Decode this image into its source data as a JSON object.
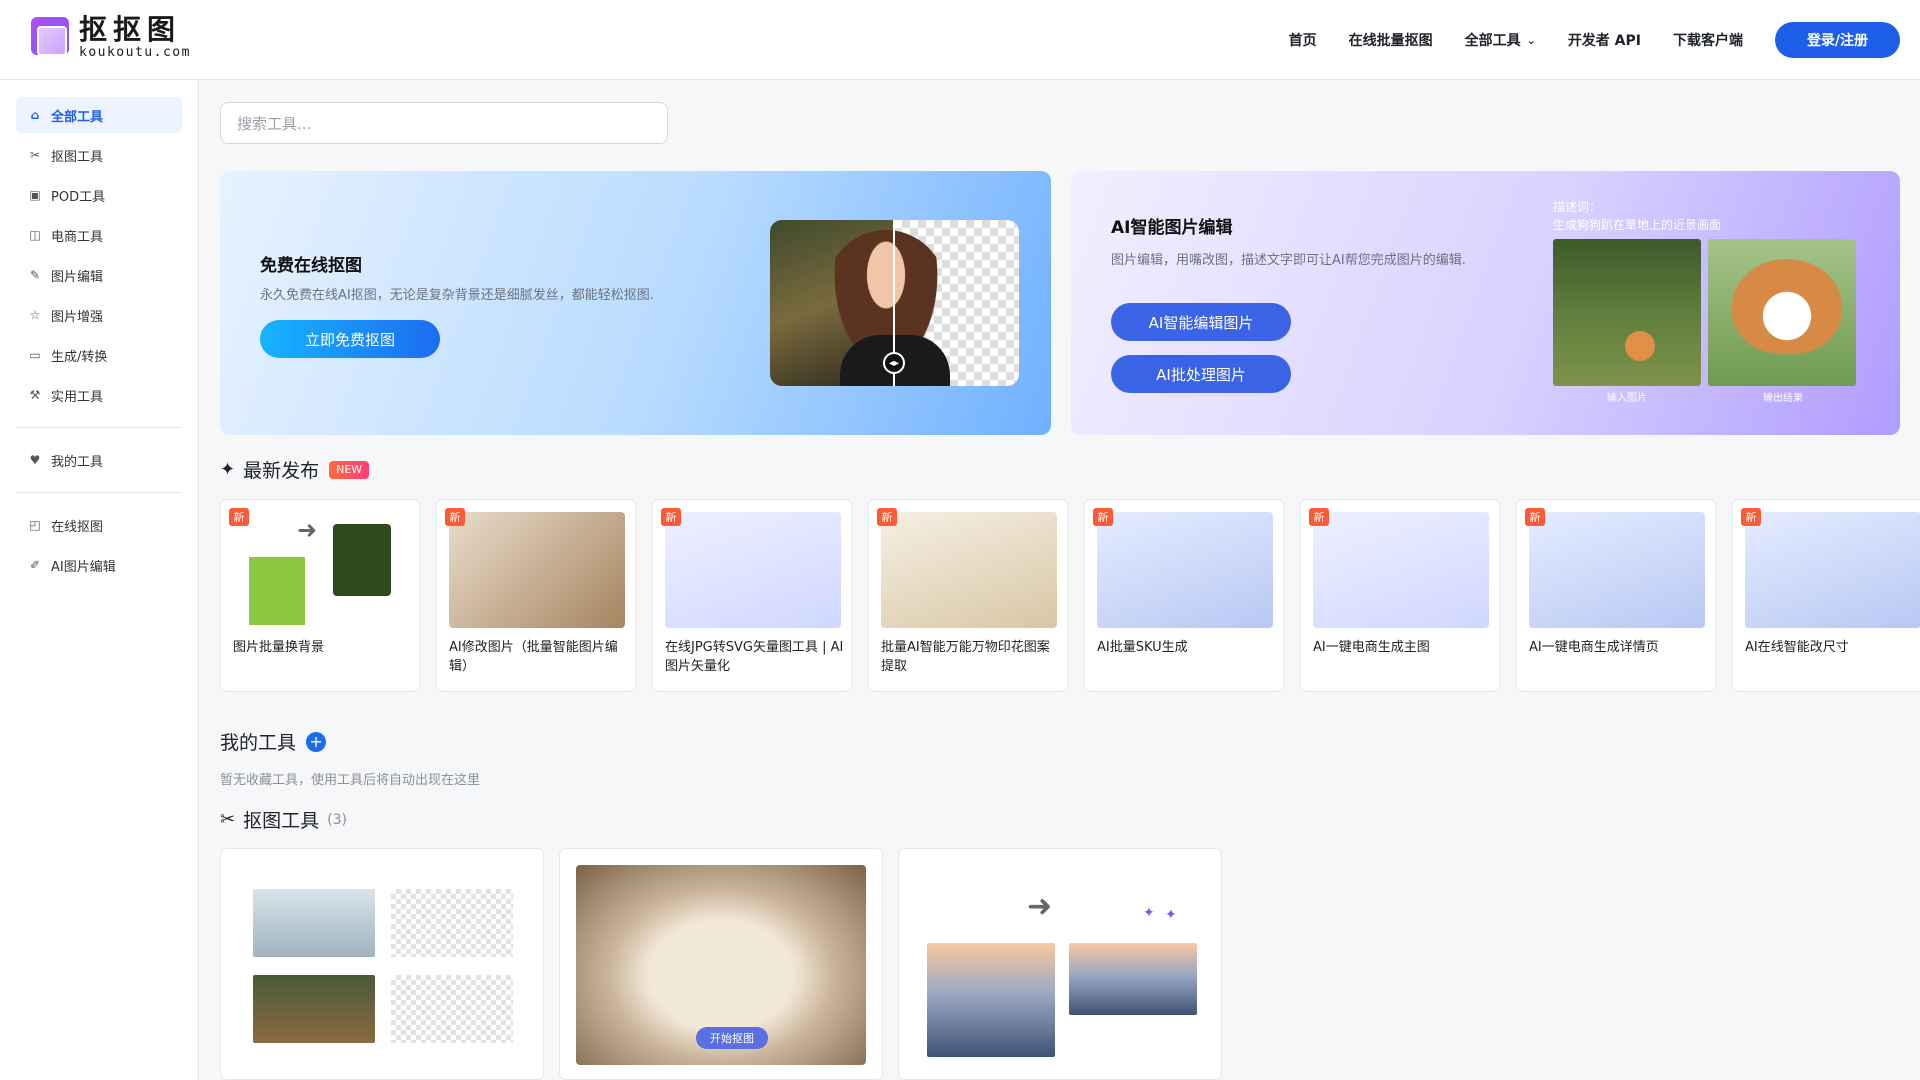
{
  "header": {
    "logo_cn": "抠抠图",
    "logo_en": "koukoutu.com",
    "nav": [
      "首页",
      "在线批量抠图",
      "全部工具",
      "开发者 API",
      "下载客户端"
    ],
    "login": "登录/注册"
  },
  "sidebar": {
    "items": [
      "全部工具",
      "抠图工具",
      "POD工具",
      "电商工具",
      "图片编辑",
      "图片增强",
      "生成/转换",
      "实用工具"
    ],
    "my_tools": "我的工具",
    "links": [
      "在线抠图",
      "AI图片编辑"
    ]
  },
  "search": {
    "placeholder": "搜索工具..."
  },
  "banner1": {
    "title": "免费在线抠图",
    "desc": "永久免费在线AI抠图，无论是复杂背景还是细腻发丝，都能轻松抠图.",
    "button": "立即免费抠图"
  },
  "banner2": {
    "title": "AI智能图片编辑",
    "desc": "图片编辑，用嘴改图，描述文字即可让AI帮您完成图片的编辑.",
    "button1": "AI智能编辑图片",
    "button2": "AI批处理图片",
    "hint_label": "描述词：",
    "hint_text": "生成狗狗趴在草地上的近景画面",
    "cap_in": "输入图片",
    "cap_out": "输出结果"
  },
  "latest": {
    "title": "最新发布",
    "tag": "NEW",
    "badge": "新",
    "cards": [
      "图片批量换背景",
      "AI修改图片（批量智能图片编辑）",
      "在线JPG转SVG矢量图工具 | AI图片矢量化",
      "批量AI智能万能万物印花图案提取",
      "AI批量SKU生成",
      "AI一键电商生成主图",
      "AI一键电商生成详情页",
      "AI在线智能改尺寸"
    ]
  },
  "my_tools": {
    "title": "我的工具",
    "hint": "暂无收藏工具，使用工具后将自动出现在这里"
  },
  "cutout": {
    "title": "抠图工具",
    "count": "(3)",
    "start": "开始抠图"
  }
}
